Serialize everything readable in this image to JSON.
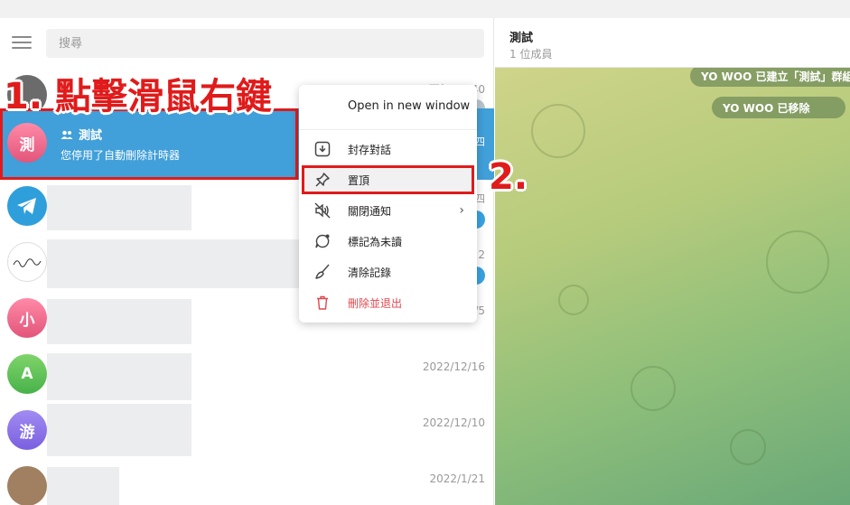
{
  "search": {
    "placeholder": "搜尋"
  },
  "annotations": {
    "step1": "1. 點擊滑鼠右鍵",
    "step2": "2."
  },
  "chats": [
    {
      "time": "下午 05:40"
    },
    {
      "name": "測試",
      "avatar_text": "測",
      "message": "您停用了自動刪除計時器",
      "time": "四"
    },
    {
      "time": "四"
    },
    {
      "time": "22"
    },
    {
      "avatar_text": "小",
      "time": "/5"
    },
    {
      "avatar_text": "A",
      "time": "2022/12/16"
    },
    {
      "avatar_text": "游",
      "time": "2022/12/10"
    },
    {
      "time": "2022/1/21"
    }
  ],
  "chat_header": {
    "title": "測試",
    "subtitle": "1 位成員"
  },
  "system_messages": [
    "YO WOO 已建立「測試」群組",
    "YO WOO 已移除"
  ],
  "context_menu": {
    "items": [
      {
        "label": "Open in new window",
        "icon": "open-window-icon"
      },
      {
        "label": "封存對話",
        "icon": "archive-icon"
      },
      {
        "label": "置頂",
        "icon": "pin-icon"
      },
      {
        "label": "關閉通知",
        "icon": "mute-icon"
      },
      {
        "label": "標記為未讀",
        "icon": "unread-icon"
      },
      {
        "label": "清除記錄",
        "icon": "broom-icon"
      },
      {
        "label": "刪除並退出",
        "icon": "trash-icon"
      }
    ]
  },
  "colors": {
    "selected": "#419fd9",
    "highlight_border": "#e01b1b",
    "danger": "#e0484f",
    "badge": "#3aa2e3"
  }
}
